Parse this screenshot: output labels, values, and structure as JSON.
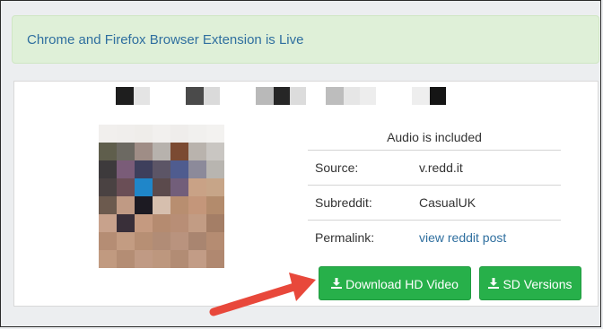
{
  "banner": {
    "text": "Chrome and Firefox Browser Extension is Live"
  },
  "info": {
    "caption": "Audio is included",
    "rows": [
      {
        "label": "Source:",
        "value": "v.redd.it"
      },
      {
        "label": "Subreddit:",
        "value": "CasualUK"
      },
      {
        "label": "Permalink:",
        "value": "view reddit post"
      }
    ]
  },
  "buttons": {
    "hd": "Download HD Video",
    "sd": "SD Versions"
  },
  "icons": {
    "download": "download-icon",
    "arrow": "red-pointer-arrow"
  },
  "colors": {
    "banner_bg": "#dff0d8",
    "link": "#2f6f9f",
    "button_green": "#27b04a",
    "arrow_red": "#e8483b"
  }
}
